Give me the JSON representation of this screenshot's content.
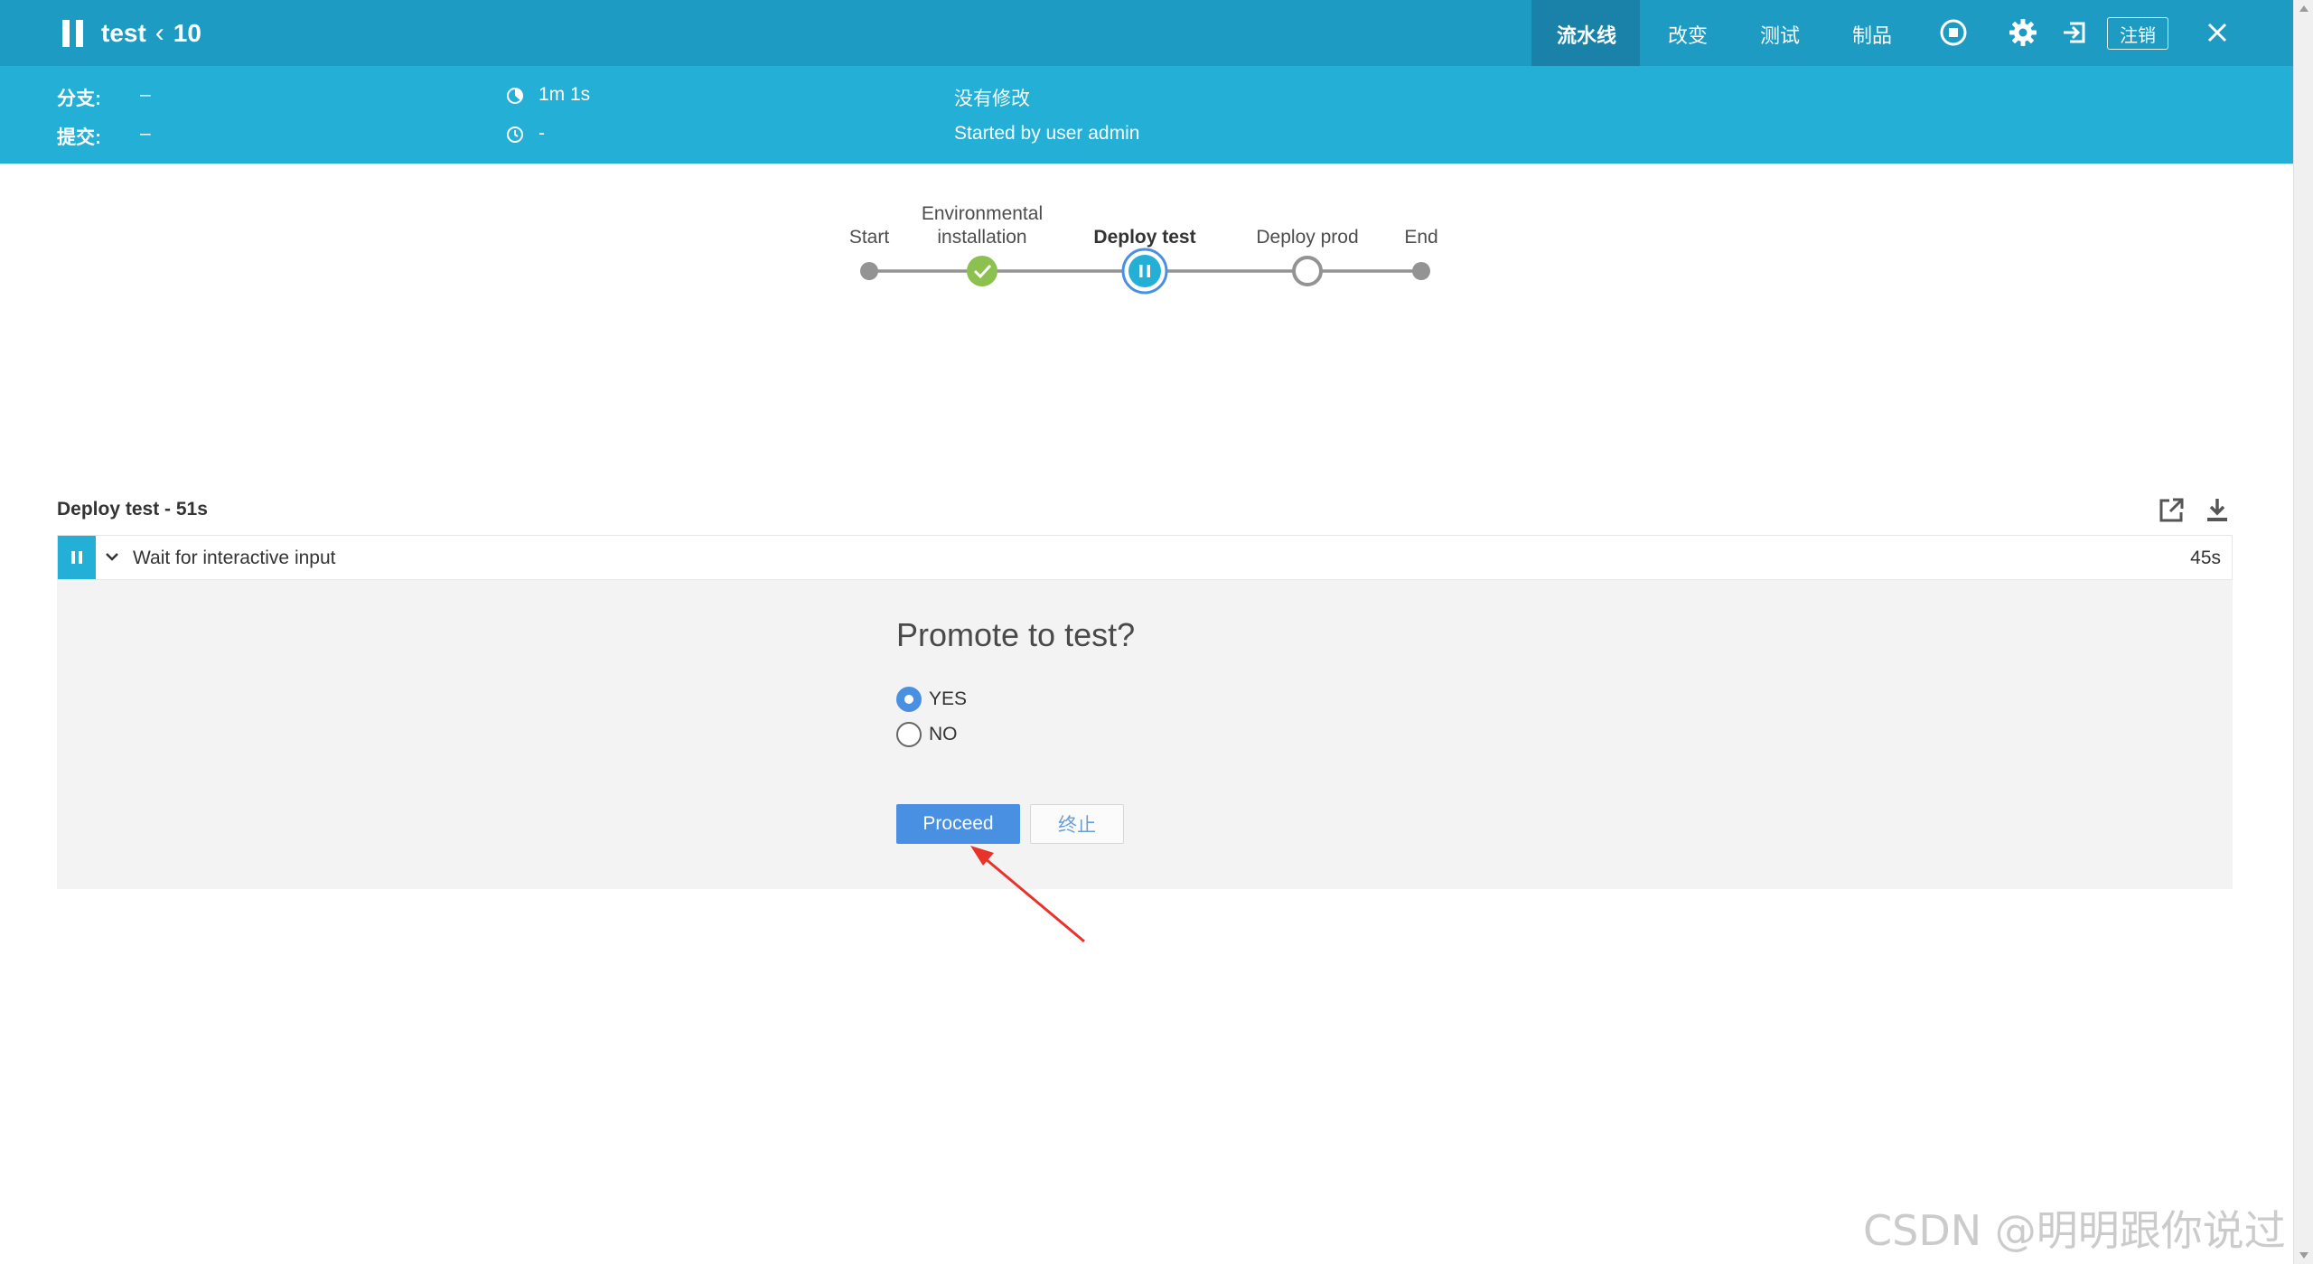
{
  "header": {
    "run_name": "test",
    "run_number": "10",
    "nav_tabs": [
      {
        "label": "流水线",
        "active": true
      },
      {
        "label": "改变",
        "active": false
      },
      {
        "label": "测试",
        "active": false
      },
      {
        "label": "制品",
        "active": false
      }
    ],
    "logout_label": "注销",
    "icons": [
      "pause-icon",
      "chevron-left-icon",
      "stop-icon",
      "gear-icon",
      "exit-icon",
      "close-icon"
    ]
  },
  "summary": {
    "branch_label": "分支:",
    "branch_value": "–",
    "commit_label": "提交:",
    "commit_value": "–",
    "duration": "1m 1s",
    "started_ago": "-",
    "changes": "没有修改",
    "cause": "Started by user admin"
  },
  "pipeline": {
    "stages": [
      {
        "name": "Start",
        "state": "start"
      },
      {
        "name": "Environmental installation",
        "state": "success"
      },
      {
        "name": "Deploy test",
        "state": "paused"
      },
      {
        "name": "Deploy prod",
        "state": "not_built"
      },
      {
        "name": "End",
        "state": "end"
      }
    ]
  },
  "log": {
    "title": "Deploy test - 51s",
    "step": {
      "name": "Wait for interactive input",
      "duration": "45s"
    },
    "input": {
      "message": "Promote to test?",
      "options": [
        {
          "label": "YES",
          "checked": true
        },
        {
          "label": "NO",
          "checked": false
        }
      ],
      "proceed_label": "Proceed",
      "abort_label": "终止"
    }
  },
  "watermark": "CSDN @明明跟你说过",
  "colors": {
    "header": "#1d9bc3",
    "subheader": "#24b0d6",
    "active_tab": "#1a82a8",
    "success": "#8cc04f",
    "paused": "#24b0d6",
    "primary_button": "#4a90e2",
    "annotation_arrow": "#e8322a"
  }
}
